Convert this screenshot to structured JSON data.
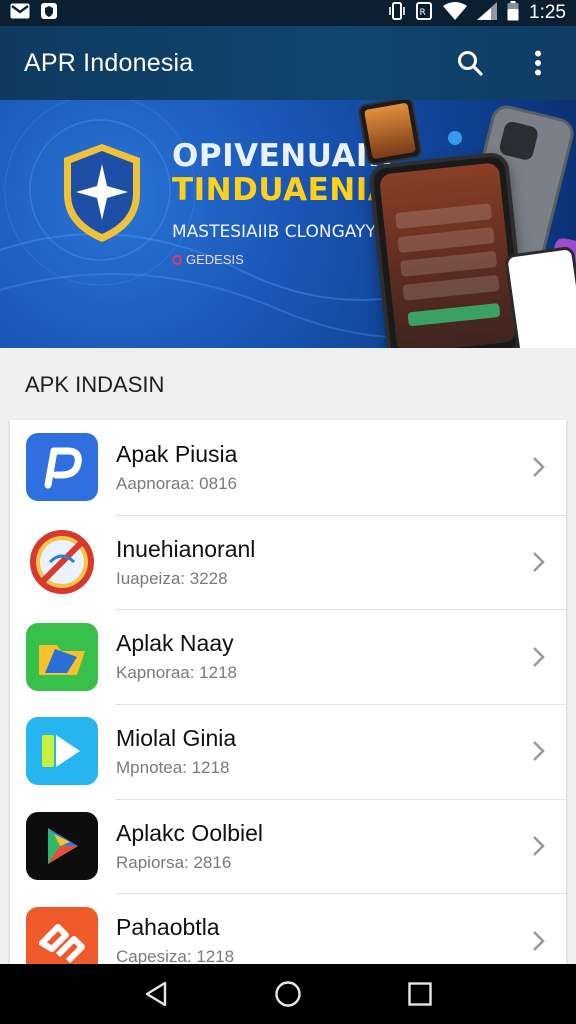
{
  "status_bar": {
    "time": "1:25",
    "icons": [
      "gmail-icon",
      "shield-notification-icon",
      "vibrate-icon",
      "sim-icon",
      "wifi-icon",
      "signal-icon",
      "battery-icon"
    ]
  },
  "app_bar": {
    "title": "APR Indonesia",
    "actions": [
      "search-icon",
      "more-vert-icon"
    ]
  },
  "banner": {
    "headline_line1": "OPIVENUAIK",
    "headline_line2": "TINDUAENIAI",
    "subtitle": "MASTESIAIIB CLONGAYY",
    "tag": "GEDESIS"
  },
  "section": {
    "title": "APK INDASIN"
  },
  "apps": [
    {
      "name": "Apak Piusia",
      "meta": "Aapnoraa: 0816",
      "icon": "p-logo-icon",
      "color": "#2f6fe0"
    },
    {
      "name": "Inuehianoranl",
      "meta": "Iuapeiza: 3228",
      "icon": "no-sign-icon",
      "color": "#f2f2f2"
    },
    {
      "name": "Aplak Naay",
      "meta": "Kapnoraa: 1218",
      "icon": "folder-icon",
      "color": "#37c04a"
    },
    {
      "name": "Miolal Ginia",
      "meta": "Mpnotea: 1218",
      "icon": "play-icon",
      "color": "#26b5ee"
    },
    {
      "name": "Aplakc Oolbiel",
      "meta": "Rapiorsa: 2816",
      "icon": "play-store-icon",
      "color": "#0d0d0d"
    },
    {
      "name": "Pahaobtla",
      "meta": "Capesiza: 1218",
      "icon": "diamond-icon",
      "color": "#ef5a2a"
    }
  ],
  "nav_bar": {
    "buttons": [
      "back-icon",
      "home-icon",
      "recents-icon"
    ]
  }
}
